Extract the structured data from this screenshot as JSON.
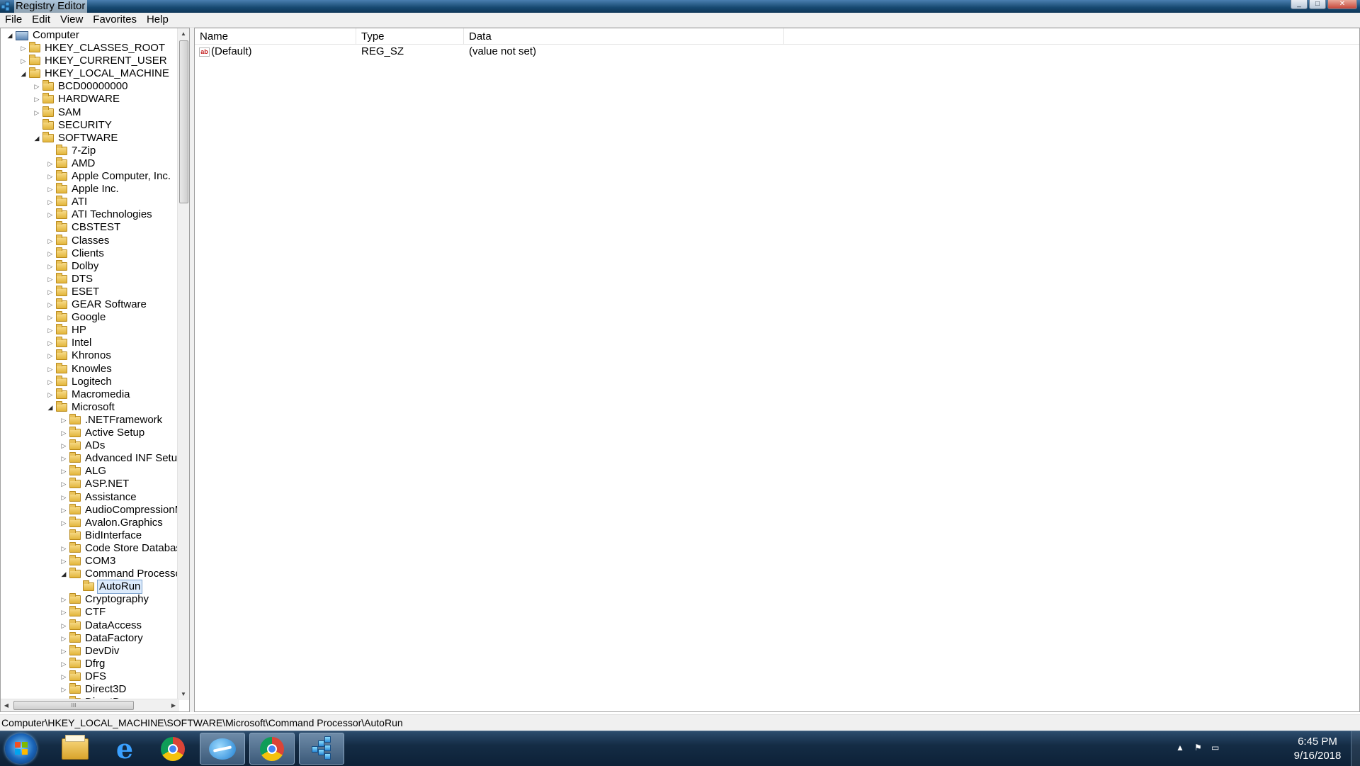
{
  "window": {
    "title": "Registry Editor"
  },
  "menu": [
    "File",
    "Edit",
    "View",
    "Favorites",
    "Help"
  ],
  "tree": {
    "root": "Computer",
    "nodes": [
      {
        "label": "HKEY_CLASSES_ROOT",
        "expander": "▷"
      },
      {
        "label": "HKEY_CURRENT_USER",
        "expander": "▷"
      },
      {
        "label": "HKEY_LOCAL_MACHINE",
        "expander": "◢"
      },
      {
        "label": "BCD00000000",
        "expander": "▷"
      },
      {
        "label": "HARDWARE",
        "expander": "▷"
      },
      {
        "label": "SAM",
        "expander": "▷"
      },
      {
        "label": "SECURITY",
        "expander": ""
      },
      {
        "label": "SOFTWARE",
        "expander": "◢"
      },
      {
        "label": "7-Zip",
        "expander": ""
      },
      {
        "label": "AMD",
        "expander": "▷"
      },
      {
        "label": "Apple Computer, Inc.",
        "expander": "▷"
      },
      {
        "label": "Apple Inc.",
        "expander": "▷"
      },
      {
        "label": "ATI",
        "expander": "▷"
      },
      {
        "label": "ATI Technologies",
        "expander": "▷"
      },
      {
        "label": "CBSTEST",
        "expander": ""
      },
      {
        "label": "Classes",
        "expander": "▷"
      },
      {
        "label": "Clients",
        "expander": "▷"
      },
      {
        "label": "Dolby",
        "expander": "▷"
      },
      {
        "label": "DTS",
        "expander": "▷"
      },
      {
        "label": "ESET",
        "expander": "▷"
      },
      {
        "label": "GEAR Software",
        "expander": "▷"
      },
      {
        "label": "Google",
        "expander": "▷"
      },
      {
        "label": "HP",
        "expander": "▷"
      },
      {
        "label": "Intel",
        "expander": "▷"
      },
      {
        "label": "Khronos",
        "expander": "▷"
      },
      {
        "label": "Knowles",
        "expander": "▷"
      },
      {
        "label": "Logitech",
        "expander": "▷"
      },
      {
        "label": "Macromedia",
        "expander": "▷"
      },
      {
        "label": "Microsoft",
        "expander": "◢"
      },
      {
        "label": ".NETFramework",
        "expander": "▷"
      },
      {
        "label": "Active Setup",
        "expander": "▷"
      },
      {
        "label": "ADs",
        "expander": "▷"
      },
      {
        "label": "Advanced INF Setup",
        "expander": "▷"
      },
      {
        "label": "ALG",
        "expander": "▷"
      },
      {
        "label": "ASP.NET",
        "expander": "▷"
      },
      {
        "label": "Assistance",
        "expander": "▷"
      },
      {
        "label": "AudioCompressionMa",
        "expander": "▷"
      },
      {
        "label": "Avalon.Graphics",
        "expander": "▷"
      },
      {
        "label": "BidInterface",
        "expander": ""
      },
      {
        "label": "Code Store Database",
        "expander": "▷"
      },
      {
        "label": "COM3",
        "expander": "▷"
      },
      {
        "label": "Command Processor",
        "expander": "◢"
      },
      {
        "label": "AutoRun",
        "expander": ""
      },
      {
        "label": "Cryptography",
        "expander": "▷"
      },
      {
        "label": "CTF",
        "expander": "▷"
      },
      {
        "label": "DataAccess",
        "expander": "▷"
      },
      {
        "label": "DataFactory",
        "expander": "▷"
      },
      {
        "label": "DevDiv",
        "expander": "▷"
      },
      {
        "label": "Dfrg",
        "expander": "▷"
      },
      {
        "label": "DFS",
        "expander": "▷"
      },
      {
        "label": "Direct3D",
        "expander": "▷"
      },
      {
        "label": "DirectDraw",
        "expander": "▷"
      }
    ],
    "hscroll_grip": "III"
  },
  "list": {
    "columns": [
      "Name",
      "Type",
      "Data"
    ],
    "rows": [
      {
        "icon": "ab",
        "name": "(Default)",
        "type": "REG_SZ",
        "data": "(value not set)"
      }
    ]
  },
  "status": "Computer\\HKEY_LOCAL_MACHINE\\SOFTWARE\\Microsoft\\Command Processor\\AutoRun",
  "taskbar": {
    "buttons": [
      "windows-explorer",
      "internet-explorer",
      "google-chrome",
      "thunderbird",
      "google-chrome",
      "registry-editor"
    ],
    "clock_time": "6:45 PM",
    "clock_date": "9/16/2018"
  },
  "colors": {
    "selection": "#dcebfc",
    "taskbar": "#142c45"
  }
}
